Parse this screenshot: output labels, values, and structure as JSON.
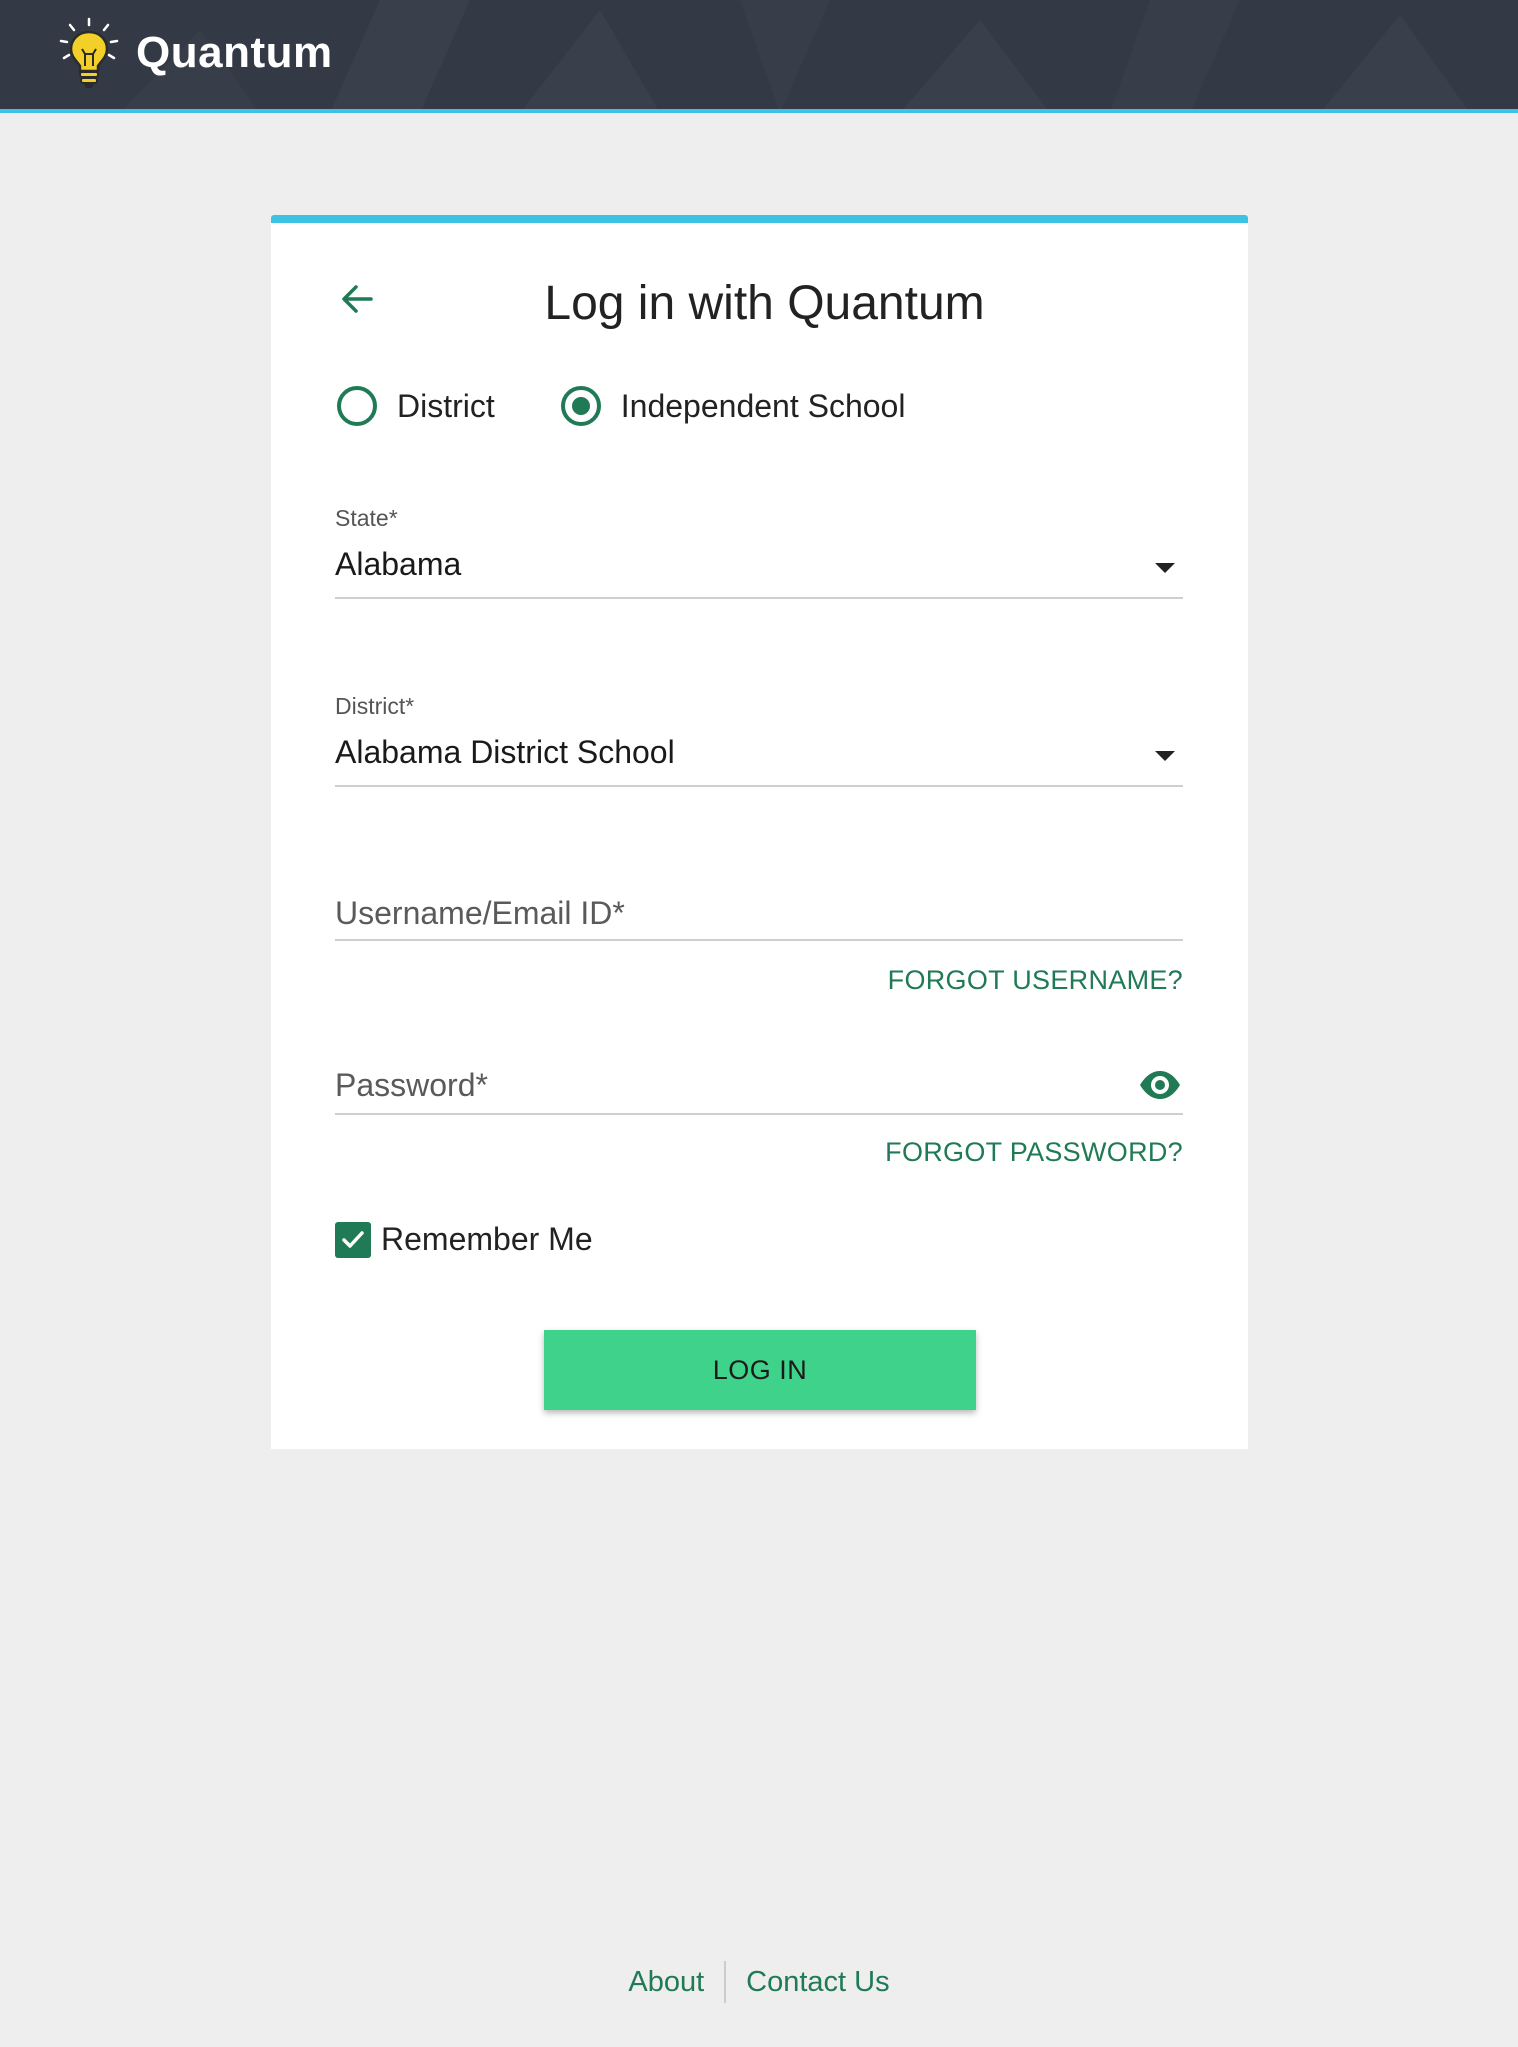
{
  "header": {
    "brand_name": "Quantum",
    "logo_icon": "lightbulb-icon",
    "background_color": "#343a45",
    "accent_color": "#3cc3e3"
  },
  "login_card": {
    "title": "Log in with Quantum",
    "back_icon": "arrow-left-icon",
    "login_type": {
      "options": [
        {
          "label": "District",
          "selected": false
        },
        {
          "label": "Independent School",
          "selected": true
        }
      ]
    },
    "state_field": {
      "label": "State*",
      "value": "Alabama"
    },
    "district_field": {
      "label": "District*",
      "value": "Alabama District School"
    },
    "username_field": {
      "placeholder": "Username/Email ID*",
      "value": ""
    },
    "forgot_username_label": "FORGOT USERNAME?",
    "password_field": {
      "placeholder": "Password*",
      "value": "",
      "toggle_icon": "eye-icon"
    },
    "forgot_password_label": "FORGOT PASSWORD?",
    "remember_me": {
      "label": "Remember Me",
      "checked": true
    },
    "login_button_label": "LOG IN",
    "primary_color": "#1f7a55",
    "button_color": "#3fd28b"
  },
  "footer": {
    "about_label": "About",
    "contact_label": "Contact Us"
  }
}
